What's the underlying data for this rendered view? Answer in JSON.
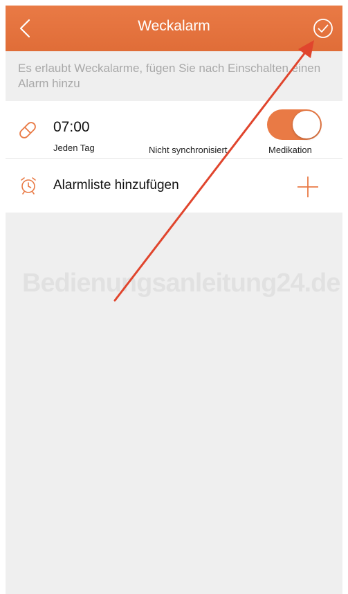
{
  "header": {
    "title": "Weckalarm",
    "back_icon": "chevron-left-icon",
    "confirm_icon": "check-circle-icon"
  },
  "hint": "Es erlaubt Weckalarme, fügen Sie nach Einschalten einen Alarm hinzu",
  "alarm": {
    "icon": "pill-icon",
    "time": "07:00",
    "repeat": "Jeden Tag",
    "sync_status": "Nicht synchronisiert",
    "type": "Medikation",
    "enabled": true
  },
  "add_alarm": {
    "icon": "alarm-clock-icon",
    "label": "Alarmliste hinzufügen",
    "action_icon": "plus-icon"
  },
  "watermark": "Bedienungsanleitung24.de",
  "colors": {
    "accent": "#e97a45",
    "annotation_arrow": "#e0452d",
    "background": "#efefef"
  }
}
